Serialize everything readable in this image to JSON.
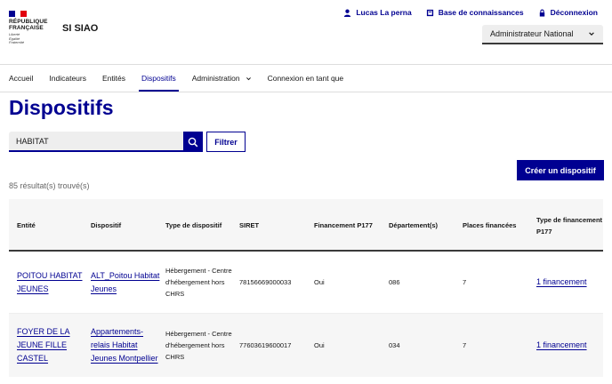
{
  "header": {
    "logo_lines": [
      "RÉPUBLIQUE",
      "FRANÇAISE"
    ],
    "motto_lines": [
      "Liberté",
      "Égalité",
      "Fraternité"
    ],
    "service_name": "SI SIAO",
    "tools": [
      {
        "label": "Lucas La perna",
        "icon": "user-icon"
      },
      {
        "label": "Base de connaissances",
        "icon": "book-icon"
      },
      {
        "label": "Déconnexion",
        "icon": "lock-icon"
      }
    ],
    "role_select": "Administrateur National"
  },
  "colors": {
    "primary": "#000091",
    "flag_blue": "#000091",
    "flag_white": "#ffffff",
    "flag_red": "#e1000f"
  },
  "nav": {
    "items": [
      {
        "label": "Accueil"
      },
      {
        "label": "Indicateurs"
      },
      {
        "label": "Entités"
      },
      {
        "label": "Dispositifs",
        "active": true
      },
      {
        "label": "Administration",
        "dropdown": true
      },
      {
        "label": "Connexion en tant que"
      }
    ]
  },
  "page": {
    "title": "Dispositifs",
    "search_value": "HABITAT",
    "filter_label": "Filtrer",
    "create_label": "Créer un dispositif",
    "result_count": "85 résultat(s) trouvé(s)"
  },
  "table": {
    "headers": [
      "Entité",
      "Dispositif",
      "Type de dispositif",
      "SIRET",
      "Financement P177",
      "Département(s)",
      "Places financées",
      "Type de financement P177"
    ],
    "rows": [
      {
        "entite": "POITOU HABITAT JEUNES",
        "dispositif": "ALT_Poitou Habitat Jeunes",
        "type": "Hébergement - Centre d'hébergement hors CHRS",
        "siret": "78156669000033",
        "financement": "Oui",
        "departement": "086",
        "places": "7",
        "type_financement": "1 financement"
      },
      {
        "entite": "FOYER DE LA JEUNE FILLE CASTEL",
        "dispositif": "Appartements-relais Habitat Jeunes Montpellier",
        "type": "Hébergement - Centre d'hébergement hors CHRS",
        "siret": "77603619600017",
        "financement": "Oui",
        "departement": "034",
        "places": "7",
        "type_financement": "1 financement"
      }
    ]
  }
}
